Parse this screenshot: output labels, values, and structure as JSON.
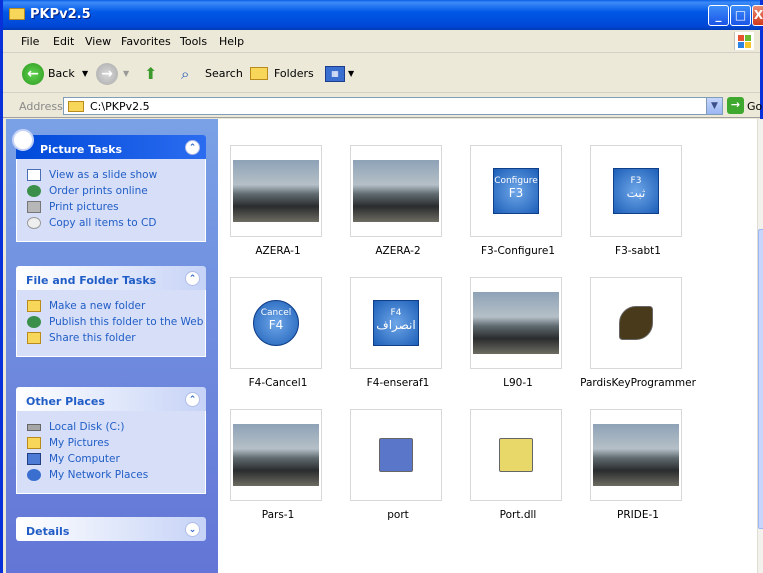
{
  "window": {
    "title": "PKPv2.5",
    "controls": [
      "_",
      "□",
      "X"
    ]
  },
  "menu": [
    "File",
    "Edit",
    "View",
    "Favorites",
    "Tools",
    "Help"
  ],
  "toolbar": {
    "back": "Back",
    "search": "Search",
    "folders": "Folders"
  },
  "address": {
    "label": "Address",
    "value": "C:\\PKPv2.5",
    "go": "Go"
  },
  "sidebar": {
    "picture_tasks": {
      "title": "Picture Tasks",
      "items": [
        "View as a slide show",
        "Order prints online",
        "Print pictures",
        "Copy all items to CD"
      ]
    },
    "file_tasks": {
      "title": "File and Folder Tasks",
      "items": [
        "Make a new folder",
        "Publish this folder to the Web",
        "Share this folder"
      ]
    },
    "other_places": {
      "title": "Other Places",
      "items": [
        "Local Disk (C:)",
        "My Pictures",
        "My Computer",
        "My Network Places"
      ]
    },
    "details": {
      "title": "Details"
    }
  },
  "files": [
    {
      "name": "AZERA-1",
      "kind": "photo"
    },
    {
      "name": "AZERA-2",
      "kind": "photo"
    },
    {
      "name": "F3-Configure1",
      "kind": "button",
      "line1": "Configure",
      "line2": "F3"
    },
    {
      "name": "F3-sabt1",
      "kind": "button",
      "line1": "F3",
      "line2": "ثبت"
    },
    {
      "name": "F4-Cancel1",
      "kind": "roundbtn",
      "line1": "Cancel",
      "line2": "F4"
    },
    {
      "name": "F4-enseraf1",
      "kind": "button",
      "line1": "F4",
      "line2": "انصراف"
    },
    {
      "name": "L90-1",
      "kind": "photo"
    },
    {
      "name": "PardisKeyProgrammer",
      "kind": "icon"
    },
    {
      "name": "Pars-1",
      "kind": "photo"
    },
    {
      "name": "port",
      "kind": "icon"
    },
    {
      "name": "Port.dll",
      "kind": "icon"
    },
    {
      "name": "PRIDE-1",
      "kind": "photo"
    }
  ],
  "colors": {
    "xp_blue": "#0058e6",
    "task_link": "#215dc6",
    "sidebar": "#7aa1e6"
  }
}
